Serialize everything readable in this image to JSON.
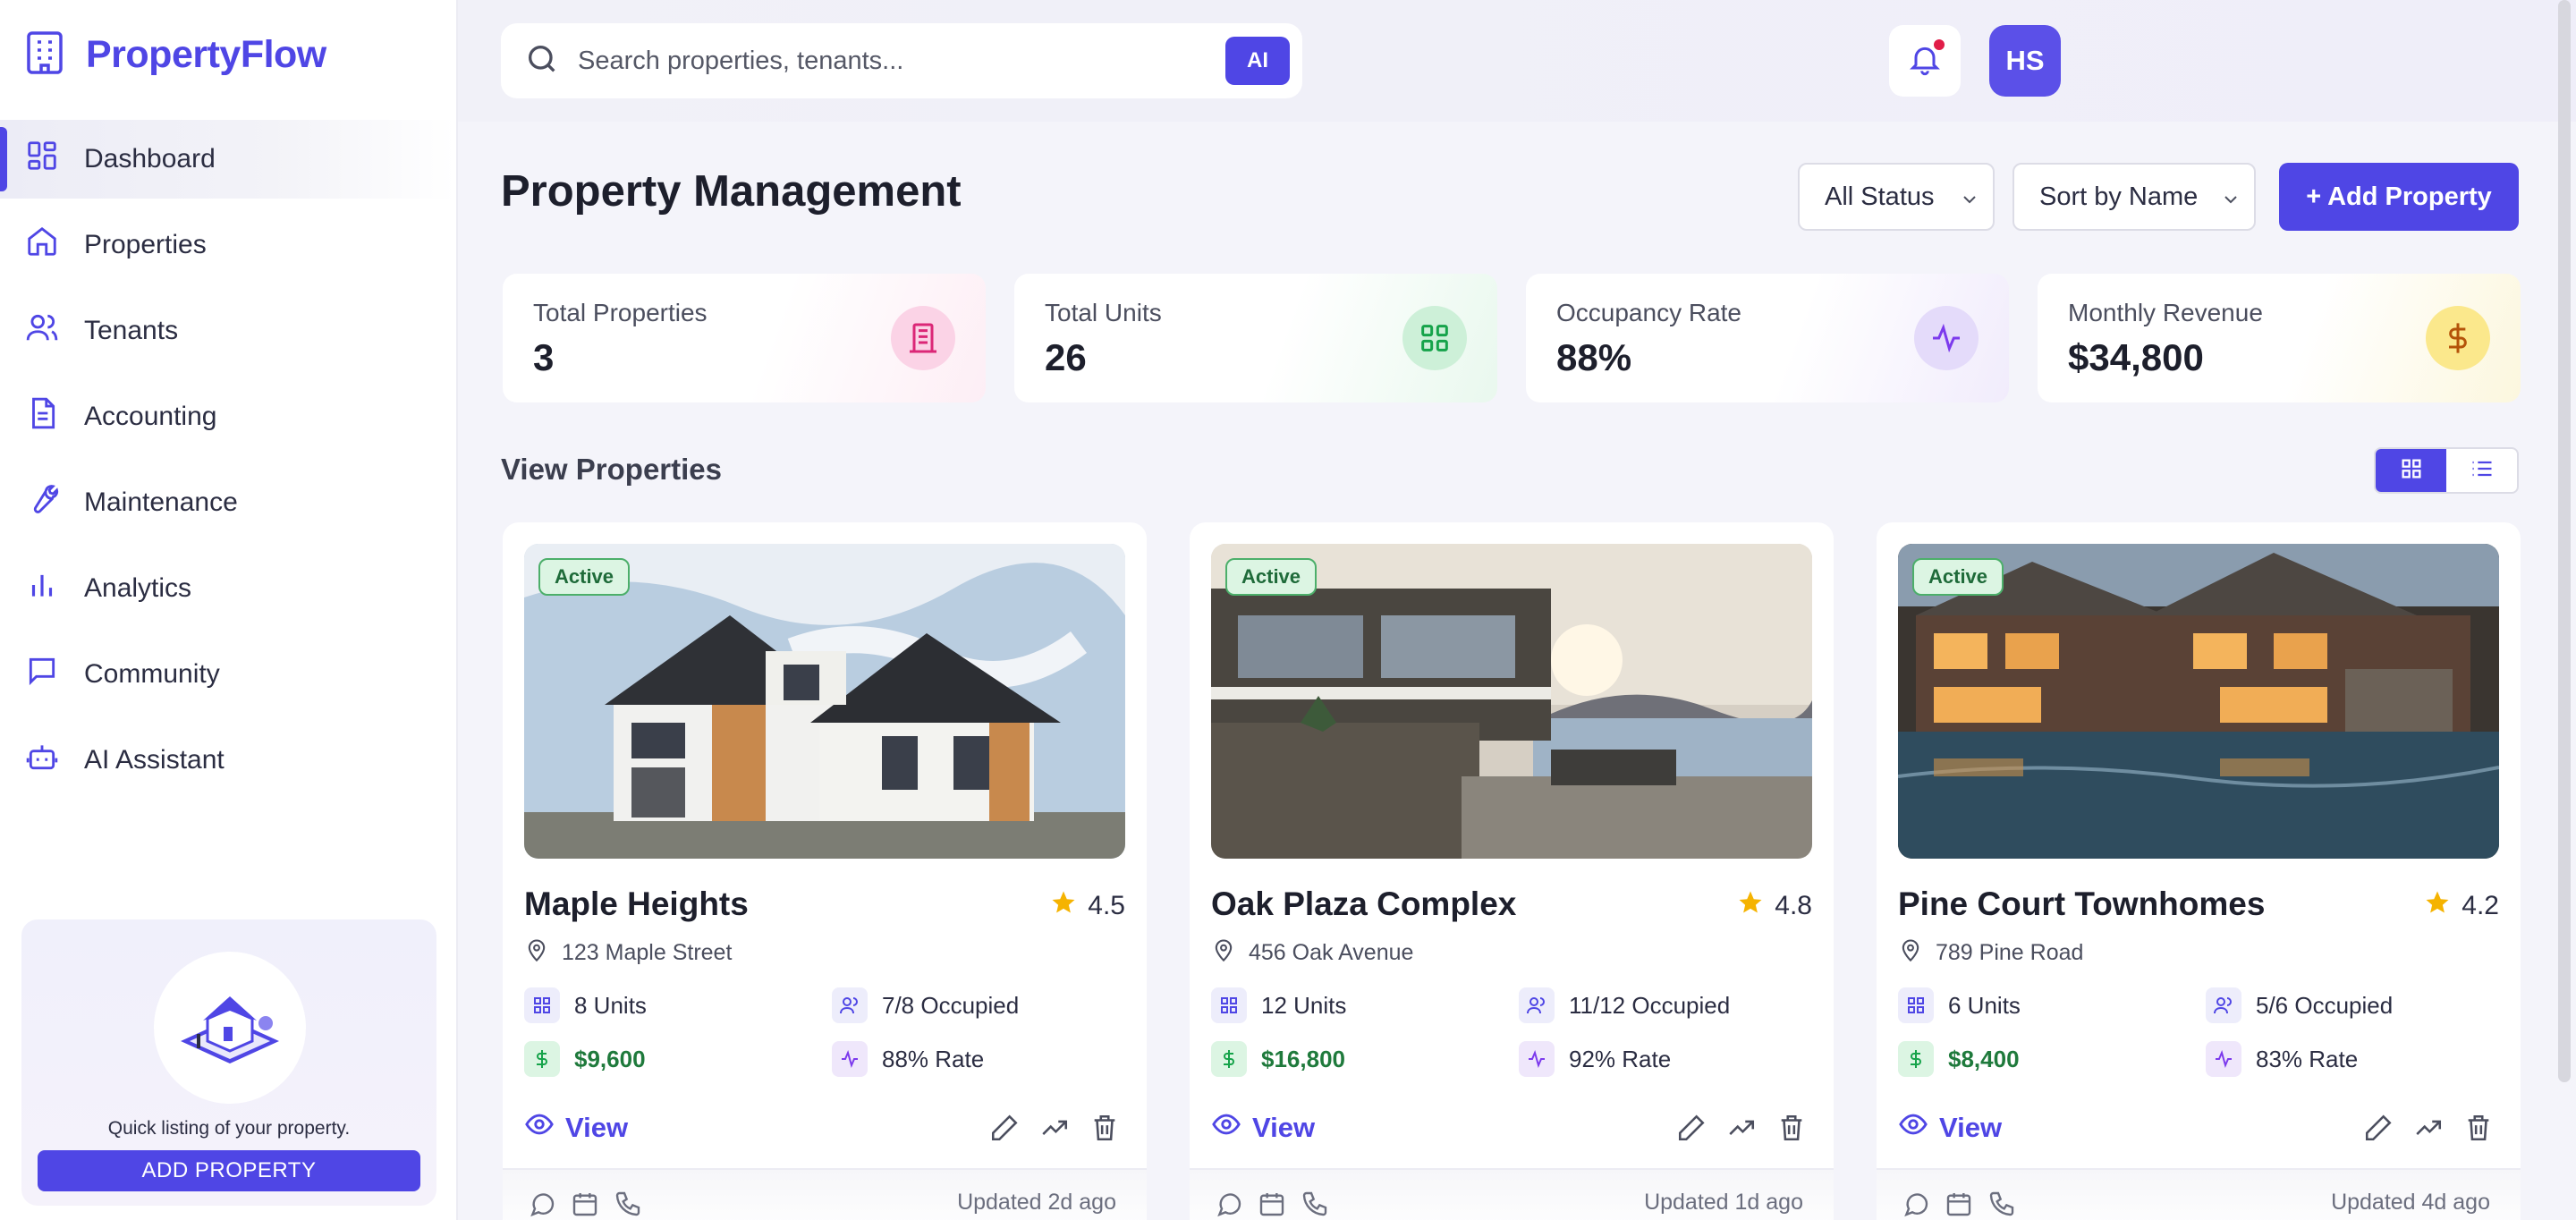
{
  "brand": {
    "name": "PropertyFlow"
  },
  "sidebar": {
    "items": [
      {
        "label": "Dashboard",
        "icon": "dashboard-icon",
        "active": true
      },
      {
        "label": "Properties",
        "icon": "home-icon"
      },
      {
        "label": "Tenants",
        "icon": "users-icon"
      },
      {
        "label": "Accounting",
        "icon": "document-icon"
      },
      {
        "label": "Maintenance",
        "icon": "wrench-icon"
      },
      {
        "label": "Analytics",
        "icon": "bar-chart-icon"
      },
      {
        "label": "Community",
        "icon": "chat-icon"
      },
      {
        "label": "AI Assistant",
        "icon": "robot-icon"
      }
    ],
    "promo": {
      "text": "Quick listing of your property.",
      "button": "ADD PROPERTY"
    }
  },
  "header": {
    "search_placeholder": "Search properties, tenants...",
    "ai_label": "AI",
    "avatar_initials": "HS"
  },
  "page": {
    "title": "Property Management",
    "status_filter": "All Status",
    "sort_select": "Sort by Name",
    "add_button": "+ Add Property",
    "section_title": "View Properties"
  },
  "stats": [
    {
      "label": "Total Properties",
      "value": "3",
      "icon": "building-icon",
      "accent": "#ec4899"
    },
    {
      "label": "Total Units",
      "value": "26",
      "icon": "grid-icon",
      "accent": "#22c55e"
    },
    {
      "label": "Occupancy Rate",
      "value": "88%",
      "icon": "activity-icon",
      "accent": "#8b5cf6"
    },
    {
      "label": "Monthly Revenue",
      "value": "$34,800",
      "icon": "dollar-icon",
      "accent": "#eab308"
    }
  ],
  "properties": [
    {
      "status": "Active",
      "name": "Maple Heights",
      "rating": "4.5",
      "address": "123 Maple Street",
      "units": "8 Units",
      "occupied": "7/8 Occupied",
      "revenue": "$9,600",
      "rate": "88% Rate",
      "view": "View",
      "updated": "Updated 2d ago"
    },
    {
      "status": "Active",
      "name": "Oak Plaza Complex",
      "rating": "4.8",
      "address": "456 Oak Avenue",
      "units": "12 Units",
      "occupied": "11/12 Occupied",
      "revenue": "$16,800",
      "rate": "92% Rate",
      "view": "View",
      "updated": "Updated 1d ago"
    },
    {
      "status": "Active",
      "name": "Pine Court Townhomes",
      "rating": "4.2",
      "address": "789 Pine Road",
      "units": "6 Units",
      "occupied": "5/6 Occupied",
      "revenue": "$8,400",
      "rate": "83% Rate",
      "view": "View",
      "updated": "Updated 4d ago"
    }
  ],
  "colors": {
    "accent": "#4f46e5",
    "success": "#1f7a3c",
    "star": "#f5b301"
  }
}
